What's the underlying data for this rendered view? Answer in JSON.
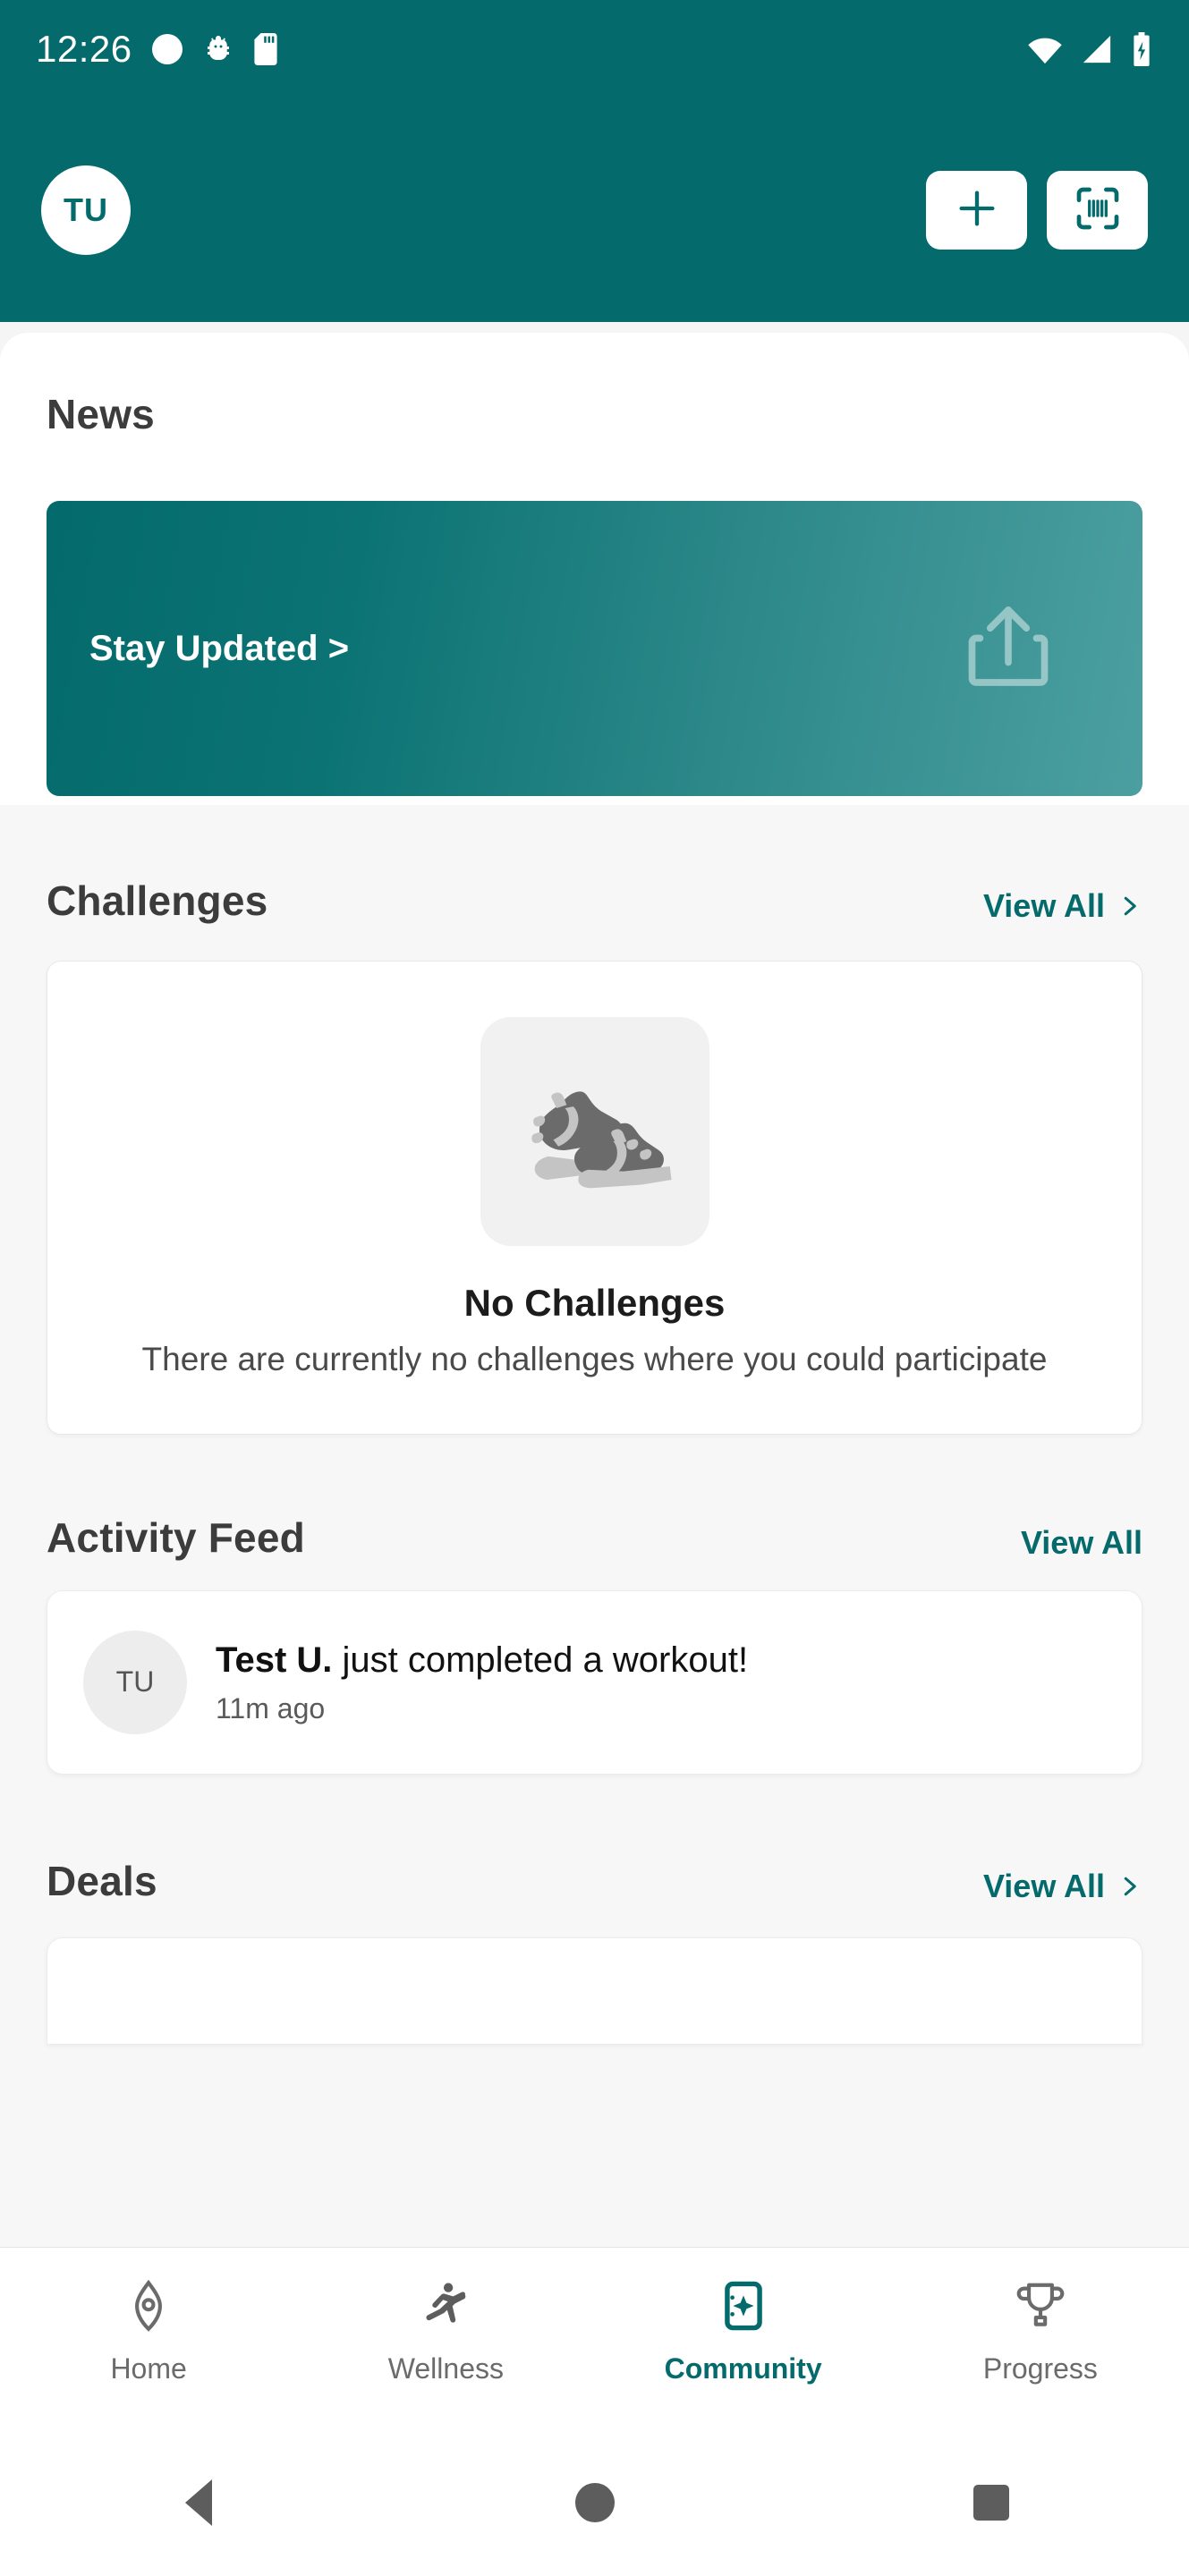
{
  "status_bar": {
    "time": "12:26",
    "left_icons": [
      "circle-icon",
      "android-debug-icon",
      "sd-card-icon"
    ],
    "right_icons": [
      "wifi-icon",
      "cell-signal-icon",
      "battery-charging-icon"
    ]
  },
  "app_bar": {
    "avatar_initials": "TU",
    "add_button_label": "+",
    "scan_button_label": "scan",
    "background_color": "#046A6C"
  },
  "news": {
    "title": "News",
    "card_label": "Stay Updated >",
    "card_icon": "share-upload-icon",
    "gradient_from": "#046A6C",
    "gradient_to": "#4C9FA0"
  },
  "challenges": {
    "title": "Challenges",
    "view_all": "View All",
    "empty_image": "sneakers-icon",
    "empty_title": "No Challenges",
    "empty_subtitle": "There are currently no challenges where you could participate"
  },
  "activity_feed": {
    "title": "Activity Feed",
    "view_all": "View All",
    "items": [
      {
        "avatar_initials": "TU",
        "author": "Test U.",
        "action": " just completed a workout!",
        "time": "11m ago"
      }
    ]
  },
  "deals": {
    "title": "Deals",
    "view_all": "View All"
  },
  "bottom_nav": {
    "active": "Community",
    "accent_color": "#046A6C",
    "inactive_color": "#6B6B6B",
    "items": [
      {
        "label": "Home",
        "icon": "home-marker-icon"
      },
      {
        "label": "Wellness",
        "icon": "person-activity-icon"
      },
      {
        "label": "Community",
        "icon": "community-screen-icon"
      },
      {
        "label": "Progress",
        "icon": "trophy-icon"
      }
    ]
  },
  "android_nav": {
    "back": "back-triangle-icon",
    "home": "home-circle-icon",
    "recents": "recents-square-icon"
  }
}
